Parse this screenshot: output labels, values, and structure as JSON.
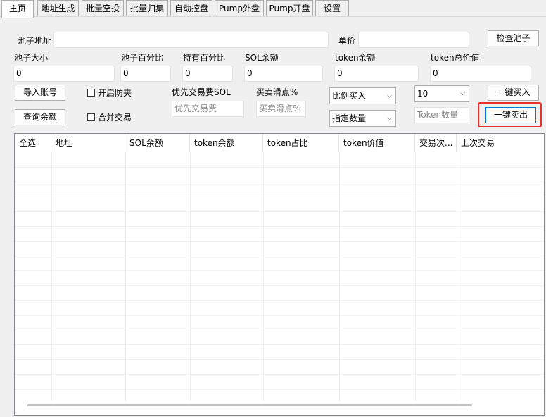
{
  "tabs": [
    {
      "label": "主页",
      "active": true
    },
    {
      "label": "地址生成"
    },
    {
      "label": "批量空投"
    },
    {
      "label": "批量归集"
    },
    {
      "label": "自动控盘"
    },
    {
      "label": "Pump外盘"
    },
    {
      "label": "Pump开盘"
    },
    {
      "label": "设置"
    }
  ],
  "pool": {
    "address_label": "池子地址",
    "address_value": "",
    "price_label": "单价",
    "price_value": "",
    "check_button": "检查池子"
  },
  "stats": {
    "pool_size_label": "池子大小",
    "pool_size_value": "0",
    "pool_pct_label": "池子百分比",
    "pool_pct_value": "0",
    "hold_pct_label": "持有百分比",
    "hold_pct_value": "0",
    "sol_balance_label": "SOL余额",
    "sol_balance_value": "0",
    "token_balance_label": "token余额",
    "token_balance_value": "0",
    "token_total_label": "token总价值",
    "token_total_value": "0"
  },
  "actions": {
    "import_button": "导入账号",
    "query_button": "查询余额",
    "anti_sandwich_label": "开启防夹",
    "merge_trade_label": "合并交易",
    "priority_fee_label": "优先交易费SOL",
    "priority_fee_placeholder": "优先交易费",
    "slippage_label": "买卖滑点%",
    "slippage_placeholder": "买卖滑点%",
    "buy_mode_selected": "比例买入",
    "sell_mode_selected": "指定数量",
    "buy_amount_selected": "10",
    "token_amount_placeholder": "Token数量",
    "buy_all_button": "一键买入",
    "sell_all_button": "一键卖出"
  },
  "table": {
    "columns": [
      "全选",
      "地址",
      "SOL余额",
      "token余额",
      "token占比",
      "token价值",
      "交易次...",
      "上次交易"
    ],
    "rows": []
  },
  "colors": {
    "highlight": "#e8312b",
    "focus_border": "#0078d7"
  }
}
